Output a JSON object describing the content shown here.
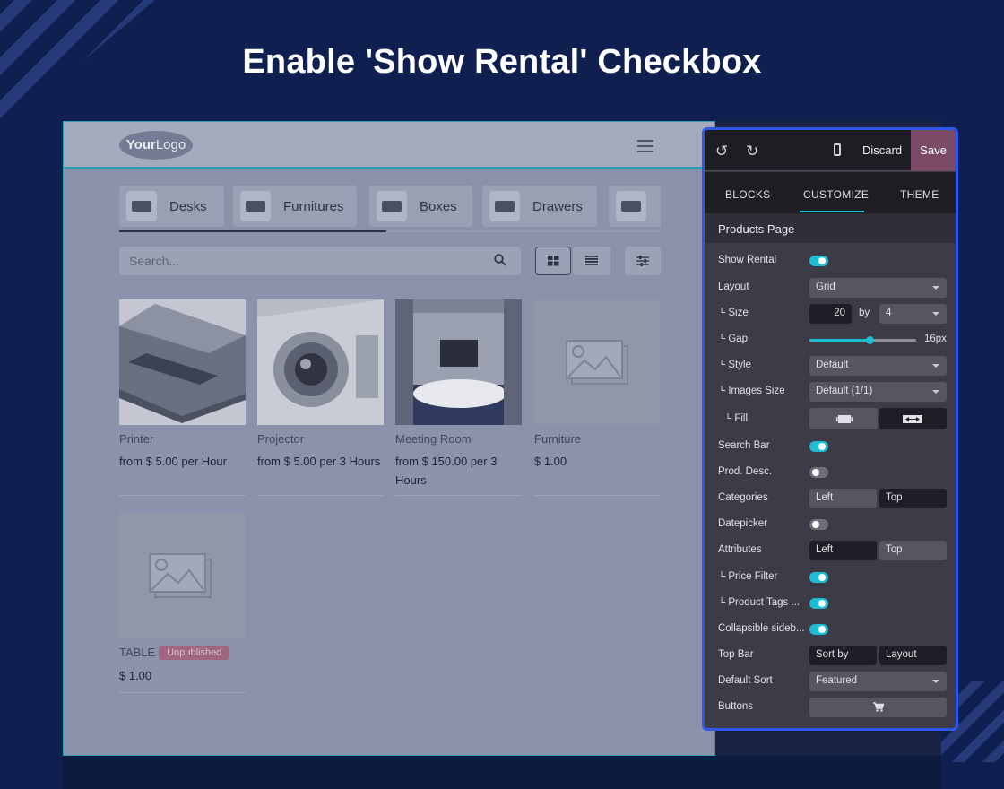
{
  "headline": "Enable 'Show Rental' Checkbox",
  "site": {
    "logo": {
      "bold": "Your",
      "rest": "Logo"
    },
    "categories": [
      {
        "label": "Desks"
      },
      {
        "label": "Furnitures"
      },
      {
        "label": "Boxes"
      },
      {
        "label": "Drawers"
      }
    ],
    "search_placeholder": "Search...",
    "products": [
      {
        "name": "Printer",
        "price": "from $ 5.00 per Hour"
      },
      {
        "name": "Projector",
        "price": "from $ 5.00 per 3 Hours"
      },
      {
        "name": "Meeting Room",
        "price": "from $ 150.00 per 3 Hours"
      },
      {
        "name": "Furniture",
        "price": "$ 1.00"
      },
      {
        "name": "TABLE",
        "badge": "Unpublished",
        "price": "$ 1.00"
      }
    ]
  },
  "panel": {
    "discard": "Discard",
    "save": "Save",
    "tabs": [
      "BLOCKS",
      "CUSTOMIZE",
      "THEME"
    ],
    "active_tab": "CUSTOMIZE",
    "section": "Products Page",
    "rows": {
      "show_rental": {
        "label": "Show Rental",
        "on": true
      },
      "layout": {
        "label": "Layout",
        "value": "Grid"
      },
      "size": {
        "label": "└ Size",
        "value": "20",
        "by": "by",
        "cols": "4"
      },
      "gap": {
        "label": "└ Gap",
        "value": "16px",
        "fraction": 0.56
      },
      "style": {
        "label": "└ Style",
        "value": "Default"
      },
      "images_size": {
        "label": "└ Images Size",
        "value": "Default (1/1)"
      },
      "fill": {
        "label": "└ Fill"
      },
      "search_bar": {
        "label": "Search Bar",
        "on": true
      },
      "prod_desc": {
        "label": "Prod. Desc.",
        "on": false
      },
      "categories": {
        "label": "Categories",
        "left": "Left",
        "top": "Top"
      },
      "datepicker": {
        "label": "Datepicker",
        "on": false
      },
      "attributes": {
        "label": "Attributes",
        "left": "Left",
        "top": "Top"
      },
      "price_filter": {
        "label": "└ Price Filter",
        "on": true
      },
      "product_tags": {
        "label": "└ Product Tags ...",
        "on": true
      },
      "collapsible": {
        "label": "Collapsible sideb...",
        "on": true
      },
      "top_bar": {
        "label": "Top Bar",
        "sort": "Sort by",
        "layout": "Layout"
      },
      "default_sort": {
        "label": "Default Sort",
        "value": "Featured"
      },
      "buttons": {
        "label": "Buttons"
      }
    }
  }
}
